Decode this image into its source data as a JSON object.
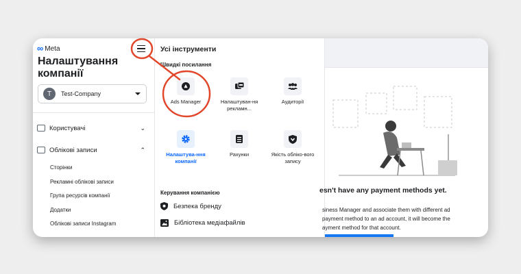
{
  "sidebar": {
    "brand": "Meta",
    "title": "Налаштування компанії",
    "company": {
      "avatar_letter": "T",
      "name": "Test-Company"
    },
    "nav": [
      {
        "label": "Користувачі",
        "expanded": false
      },
      {
        "label": "Облікові записи",
        "expanded": true
      }
    ],
    "sub_items": [
      "Сторінки",
      "Рекламні облікові записи",
      "Група ресурсів компанії",
      "Додатки",
      "Облікові записи Instagram"
    ]
  },
  "tools": {
    "title": "Усі інструменти",
    "quick_links_title": "Швидкі посилання",
    "quick_links": [
      {
        "label": "Ads Manager",
        "icon": "ads-manager-icon"
      },
      {
        "label": "Налаштуван-ня рекламн...",
        "icon": "ad-settings-icon"
      },
      {
        "label": "Аудиторії",
        "icon": "audiences-icon"
      },
      {
        "label": "Налаштува-ння компанії",
        "icon": "gear-icon"
      },
      {
        "label": "Рахунки",
        "icon": "billing-icon"
      },
      {
        "label": "Якість обліко-вого запису",
        "icon": "shield-icon"
      }
    ],
    "management_title": "Керування компанією",
    "management": [
      {
        "label": "Безпека бренду",
        "icon": "brand-safety-icon"
      },
      {
        "label": "Бібліотека медіафайлів",
        "icon": "media-library-icon"
      }
    ]
  },
  "content": {
    "empty_title": "esn't have any payment methods yet.",
    "empty_desc_1": "siness Manager and associate them with different ad",
    "empty_desc_2": "payment method to an ad account, it will become the",
    "empty_desc_3": "ayment method for that account."
  },
  "colors": {
    "accent": "#0866ff",
    "annotation": "#e2472c",
    "link": "#1877f2"
  }
}
